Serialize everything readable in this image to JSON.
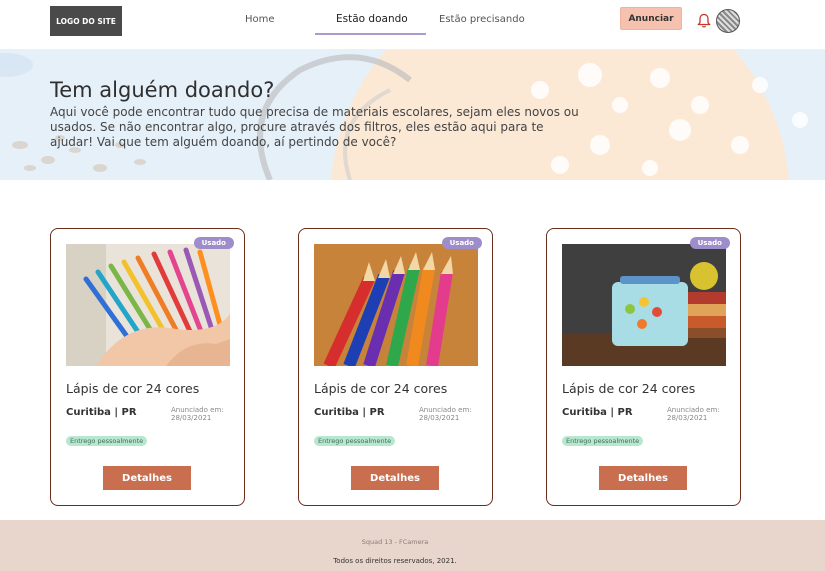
{
  "header": {
    "logo": "LOGO DO SITE",
    "nav": [
      {
        "label": "Home",
        "active": false
      },
      {
        "label": "Estão doando",
        "active": true
      },
      {
        "label": "Estão precisando",
        "active": false
      }
    ],
    "cta_label": "Anunciar",
    "icons": [
      "bell-icon",
      "user-avatar"
    ],
    "colors": {
      "cta": "#f6c1ae",
      "active_underline": "#a99bd0"
    }
  },
  "hero": {
    "title": "Tem alguém doando?",
    "text": "Aqui você pode encontrar tudo que precisa de materiais escolares, sejam eles novos ou usados. Se não encontrar algo, procure através dos filtros, eles estão aqui para te ajudar! Vai que tem alguém doando, aí pertindo de você?"
  },
  "cards": [
    {
      "badge": "Usado",
      "title": "Lápis de cor 24 cores",
      "location": "Curitiba | PR",
      "date": "Anunciado em: 28/03/2021",
      "tag": "Entrego pessoalmente",
      "button": "Detalhes",
      "image": "colorful pens in hand"
    },
    {
      "badge": "Usado",
      "title": "Lápis de cor 24 cores",
      "location": "Curitiba | PR",
      "date": "Anunciado em: 28/03/2021",
      "tag": "Entrego pessoalmente",
      "button": "Detalhes",
      "image": "colored pencils"
    },
    {
      "badge": "Usado",
      "title": "Lápis de cor 24 cores",
      "location": "Curitiba | PR",
      "date": "Anunciado em: 28/03/2021",
      "tag": "Entrego pessoalmente",
      "button": "Detalhes",
      "image": "lunch box with books and apple"
    }
  ],
  "footer": {
    "squad": "Squad 13 - FCamera",
    "rights": "Todos os direitos reservados, 2021."
  },
  "colors": {
    "card_border": "#6b2e1a",
    "badge": "#9d8ecb",
    "tag": "#b8e6cf",
    "button": "#c96e4f",
    "footer": "#e8d6cd"
  }
}
